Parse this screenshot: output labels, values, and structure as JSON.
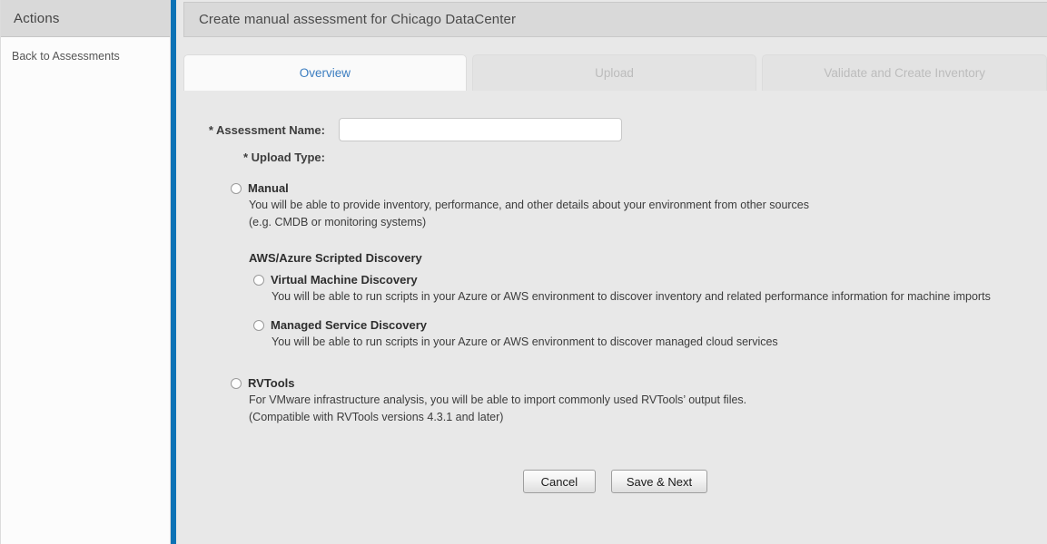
{
  "sidebar": {
    "header_title": "Actions",
    "links": [
      {
        "label": "Back to Assessments"
      }
    ]
  },
  "header": {
    "title": "Create manual assessment for Chicago DataCenter"
  },
  "tabs": [
    {
      "label": "Overview",
      "state": "active"
    },
    {
      "label": "Upload",
      "state": "disabled"
    },
    {
      "label": "Validate and Create Inventory",
      "state": "disabled"
    }
  ],
  "form": {
    "assessment_name_label": "* Assessment Name:",
    "assessment_name_value": "",
    "assessment_name_placeholder": "",
    "upload_type_label": "* Upload Type:",
    "group_heading": "AWS/Azure Scripted Discovery",
    "options": [
      {
        "title": "Manual",
        "desc_line1": "You will be able to provide inventory, performance, and other details about your environment from other sources",
        "desc_line2": "(e.g. CMDB or monitoring systems)",
        "selected": false
      },
      {
        "title": "Virtual Machine Discovery",
        "desc_line1": "You will be able to run scripts in your Azure or AWS environment to discover inventory and related performance information for machine imports",
        "desc_line2": "",
        "selected": false
      },
      {
        "title": "Managed Service Discovery",
        "desc_line1": "You will be able to run scripts in your Azure or AWS environment to discover managed cloud services",
        "desc_line2": "",
        "selected": false
      },
      {
        "title": "RVTools",
        "desc_line1": "For VMware infrastructure analysis, you will be able to import commonly used RVTools’ output files.",
        "desc_line2": "(Compatible with RVTools versions 4.3.1 and later)",
        "selected": false
      }
    ]
  },
  "buttons": {
    "cancel_label": "Cancel",
    "save_next_label": "Save & Next"
  },
  "colors": {
    "accent_blue": "#0c72b5",
    "tab_active_text": "#3b7dc0",
    "content_bg": "#e8e8e8",
    "header_bg": "#d9d9d9"
  }
}
